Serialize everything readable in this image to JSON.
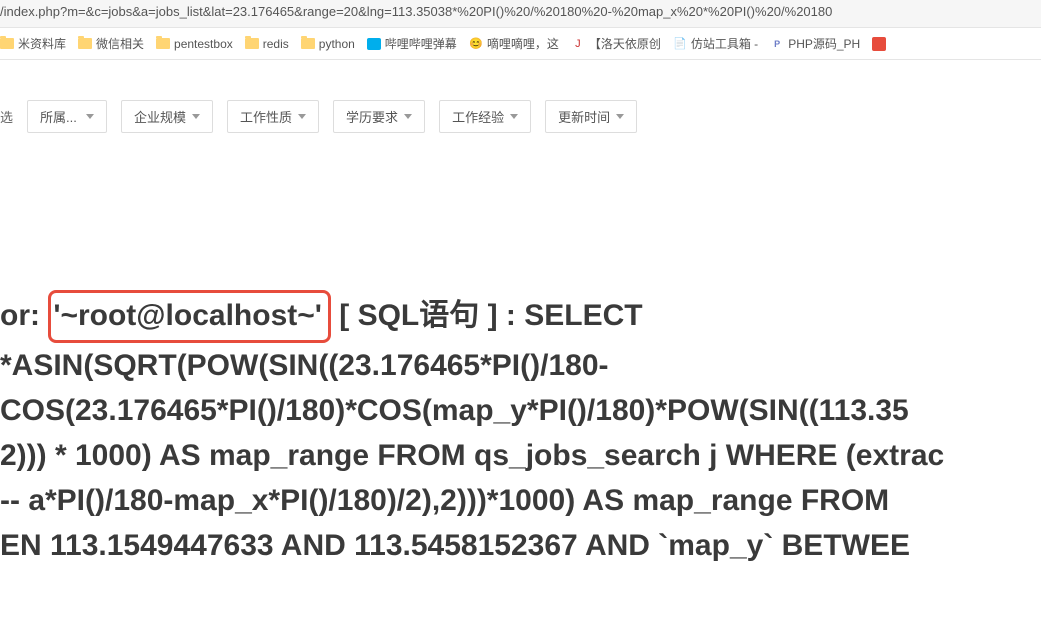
{
  "url": "/index.php?m=&c=jobs&a=jobs_list&lat=23.176465&range=20&lng=113.35038*%20PI()%20/%20180%20-%20map_x%20*%20PI()%20/%20180",
  "bookmarks": [
    {
      "label": "米资料库",
      "icon": "folder"
    },
    {
      "label": "微信相关",
      "icon": "folder"
    },
    {
      "label": "pentestbox",
      "icon": "folder"
    },
    {
      "label": "redis",
      "icon": "folder"
    },
    {
      "label": "python",
      "icon": "folder"
    },
    {
      "label": "哔哩哔哩弹幕",
      "icon": "bili"
    },
    {
      "label": "嘀哩嘀哩，这",
      "icon": "other"
    },
    {
      "label": "【洛天依原创",
      "icon": "j"
    },
    {
      "label": "仿站工具箱 -",
      "icon": "doc"
    },
    {
      "label": "PHP源码_PH",
      "icon": "php"
    },
    {
      "label": "",
      "icon": "red"
    }
  ],
  "filter": {
    "label": "选",
    "options": [
      {
        "label": "所属..."
      },
      {
        "label": "企业规模"
      },
      {
        "label": "工作性质"
      },
      {
        "label": "学历要求"
      },
      {
        "label": "工作经验"
      },
      {
        "label": "更新时间"
      }
    ]
  },
  "error": {
    "line1_prefix": "or: ",
    "line1_highlight": "'~root@localhost~'",
    "line1_suffix": " [ SQL语句 ] : SELECT",
    "line2": "*ASIN(SQRT(POW(SIN((23.176465*PI()/180-",
    "line3": "COS(23.176465*PI()/180)*COS(map_y*PI()/180)*POW(SIN((113.35",
    "line4": "2))) * 1000) AS map_range FROM qs_jobs_search j WHERE (extrac",
    "line5": " -- a*PI()/180-map_x*PI()/180)/2),2)))*1000) AS map_range FROM",
    "line6": "EN 113.1549447633 AND 113.5458152367 AND `map_y` BETWEE"
  }
}
